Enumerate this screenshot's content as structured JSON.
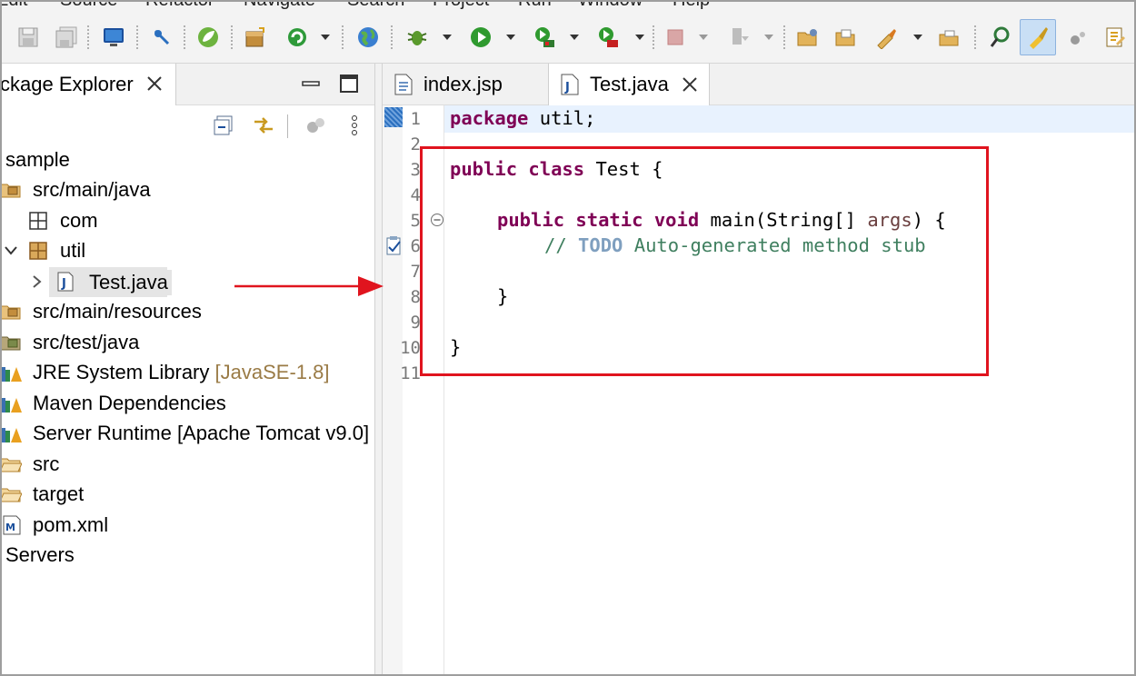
{
  "menu": {
    "items": [
      "Edit",
      "Source",
      "Refactor",
      "Navigate",
      "Search",
      "Project",
      "Run",
      "Window",
      "Help"
    ]
  },
  "toolbar": {
    "icons": [
      "save-icon",
      "save-all-icon",
      "terminal-icon",
      "toggle-breakpoint-icon",
      "spring-icon",
      "package-icon",
      "refresh-icon",
      "globe-icon",
      "debug-icon",
      "run-icon",
      "run-server-icon",
      "stop-server-icon",
      "terminate-icon",
      "external-tools-icon",
      "open-folder-icon",
      "open-type-icon",
      "brush-icon",
      "open-task-icon",
      "search-icon",
      "highlight-icon",
      "paint-icon",
      "publish-icon"
    ]
  },
  "package_explorer": {
    "tab_label": "ckage Explorer",
    "tree": [
      {
        "label": "sample",
        "icon": "project-icon",
        "level": 0
      },
      {
        "label": "src/main/java",
        "icon": "source-folder-icon",
        "level": 1
      },
      {
        "label": "com",
        "icon": "package-icon",
        "level": 2
      },
      {
        "label": "util",
        "icon": "package-icon",
        "level": 2,
        "expanded": true
      },
      {
        "label": "Test.java",
        "icon": "java-file-icon",
        "level": 3,
        "selected": true
      },
      {
        "label": "src/main/resources",
        "icon": "source-folder-icon",
        "level": 1
      },
      {
        "label": "src/test/java",
        "icon": "source-folder-icon",
        "level": 1
      },
      {
        "label": "JRE System Library",
        "decor": "[JavaSE-1.8]",
        "icon": "library-icon",
        "level": 1
      },
      {
        "label": "Maven Dependencies",
        "icon": "library-icon",
        "level": 1
      },
      {
        "label": "Server Runtime [Apache Tomcat v9.0]",
        "icon": "library-icon",
        "level": 1
      },
      {
        "label": "src",
        "icon": "folder-icon",
        "level": 1
      },
      {
        "label": "target",
        "icon": "folder-icon",
        "level": 1
      },
      {
        "label": "pom.xml",
        "icon": "maven-file-icon",
        "level": 1
      },
      {
        "label": "Servers",
        "icon": "",
        "level": 0
      }
    ]
  },
  "editor": {
    "tabs": [
      {
        "label": "index.jsp",
        "icon": "jsp-file-icon",
        "active": false
      },
      {
        "label": "Test.java",
        "icon": "java-file-icon",
        "active": true
      }
    ],
    "line_numbers": [
      "1",
      "2",
      "3",
      "4",
      "5",
      "6",
      "7",
      "8",
      "9",
      "10",
      "11"
    ],
    "code": {
      "l1_kw": "package",
      "l1_rest": " util;",
      "l3_kw1": "public",
      "l3_kw2": "class",
      "l3_rest": " Test {",
      "l5_kw1": "public",
      "l5_kw2": "static",
      "l5_kw3": "void",
      "l5_mid": " main(String[] ",
      "l5_param": "args",
      "l5_end": ") {",
      "l6_comment1": "// ",
      "l6_todo": "TODO",
      "l6_comment2": " Auto-generated method stub",
      "l8_text": "}",
      "l10_text": "}"
    }
  },
  "colors": {
    "keyword": "#7f0055",
    "comment": "#3f7f5f",
    "todo": "#7f9fbf",
    "annotation": "#e0141e"
  }
}
